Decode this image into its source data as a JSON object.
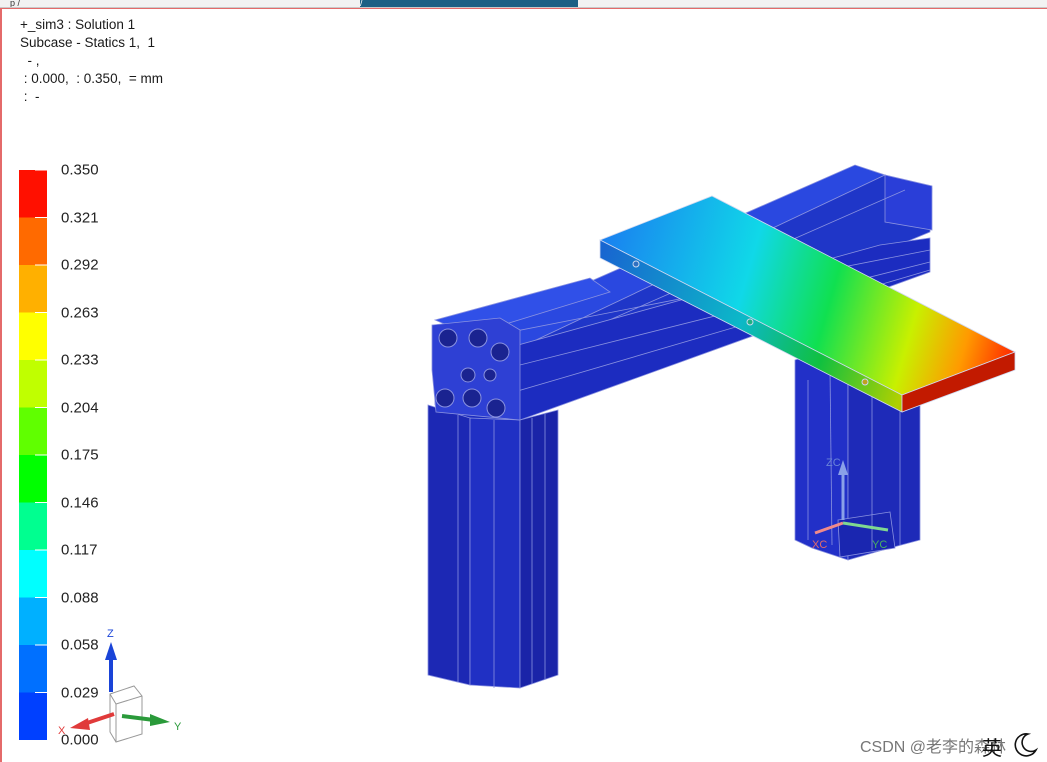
{
  "tabs": [
    {
      "label": "p   /   _",
      "active": false
    },
    {
      "label": "  /   _",
      "active": true
    }
  ],
  "header": {
    "line1": "+_sim3 : Solution 1",
    "line2": "Subcase - Statics 1,  1",
    "line3": "  - ,",
    "line4": " : 0.000,  : 0.350,  = mm",
    "line5": " :  -"
  },
  "legend": {
    "labels": [
      "0.350",
      "0.321",
      "0.292",
      "0.263",
      "0.233",
      "0.204",
      "0.175",
      "0.146",
      "0.117",
      "0.088",
      "0.058",
      "0.029",
      "0.000"
    ],
    "colors": [
      "#ff1000",
      "#ff6a00",
      "#ffb000",
      "#ffff00",
      "#c0ff00",
      "#60ff00",
      "#00ff00",
      "#00ff90",
      "#00ffff",
      "#00b0ff",
      "#0070ff",
      "#0040ff",
      "#0000ff"
    ]
  },
  "triad_left": {
    "z": "Z",
    "x": "X",
    "y": "Y"
  },
  "triad_model": {
    "z": "ZC",
    "x": "XC",
    "y": "YC"
  },
  "watermark": "CSDN @老李的森林",
  "ime": {
    "char": "英"
  }
}
